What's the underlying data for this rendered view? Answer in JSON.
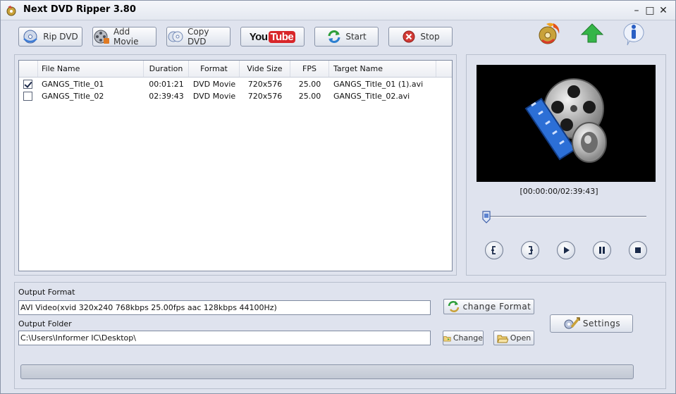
{
  "window": {
    "title": "Next DVD Ripper 3.80",
    "controls": {
      "minimize": "–",
      "maximize": "□",
      "close": "✕"
    }
  },
  "toolbar": {
    "rip_dvd": "Rip DVD",
    "add_movie": "Add Movie",
    "copy_dvd": "Copy DVD",
    "youtube_you": "You",
    "youtube_tube": "Tube",
    "start": "Start",
    "stop": "Stop"
  },
  "top_icons": [
    "burn-disc-icon",
    "update-arrow-icon",
    "info-icon"
  ],
  "file_list": {
    "columns": [
      "File Name",
      "Duration",
      "Format",
      "Vide Size",
      "FPS",
      "Target Name"
    ],
    "rows": [
      {
        "checked": true,
        "file_name": "GANGS_Title_01",
        "duration": "00:01:21",
        "format": "DVD Movie",
        "video_size": "720x576",
        "fps": "25.00",
        "target_name": "GANGS_Title_01 (1).avi"
      },
      {
        "checked": false,
        "file_name": "GANGS_Title_02",
        "duration": "02:39:43",
        "format": "DVD Movie",
        "video_size": "720x576",
        "fps": "25.00",
        "target_name": "GANGS_Title_02.avi"
      }
    ]
  },
  "preview": {
    "timecode": "[00:00:00/02:39:43]",
    "position_fraction": 0.0,
    "controls": [
      "mark-in-icon",
      "mark-out-icon",
      "play-icon",
      "pause-icon",
      "stop-icon"
    ]
  },
  "output": {
    "format_label": "Output Format",
    "format_value": "AVI Video(xvid 320x240 768kbps 25.00fps aac 128kbps 44100Hz)",
    "change_format_button": "change Format",
    "folder_label": "Output Folder",
    "folder_value": "C:\\Users\\Informer IC\\Desktop\\",
    "change_button": "Change",
    "open_button": "Open",
    "settings_button": "Settings"
  },
  "progress": {
    "fraction": 0.0
  },
  "colors": {
    "window_bg": "#dfe3ee",
    "youtube_red": "#d8262a",
    "start_green": "#2e9e3a",
    "stop_red": "#d23a35"
  }
}
